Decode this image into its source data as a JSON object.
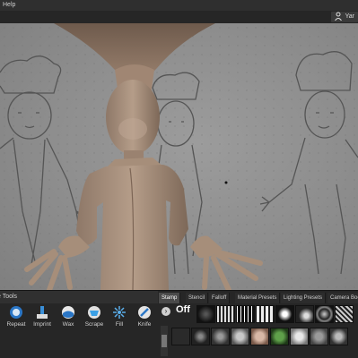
{
  "menu": {
    "help_label": "Help"
  },
  "user": {
    "name": "Yar"
  },
  "tools": {
    "header": "e Tools",
    "items": [
      {
        "label": "Repeat"
      },
      {
        "label": "Imprint"
      },
      {
        "label": "Wax"
      },
      {
        "label": "Scrape"
      },
      {
        "label": "Fill"
      },
      {
        "label": "Knife"
      }
    ]
  },
  "tabs": [
    "Stamp",
    "Stencil",
    "Falloff",
    "Material Presets",
    "Lighting Presets",
    "Camera Boo"
  ],
  "stamp": {
    "off_label": "Off"
  },
  "colors": {
    "accent_blue": "#3aa0e6",
    "sculpt_clay": "#a8907c",
    "viewport_bg": "#8f8f8f"
  }
}
